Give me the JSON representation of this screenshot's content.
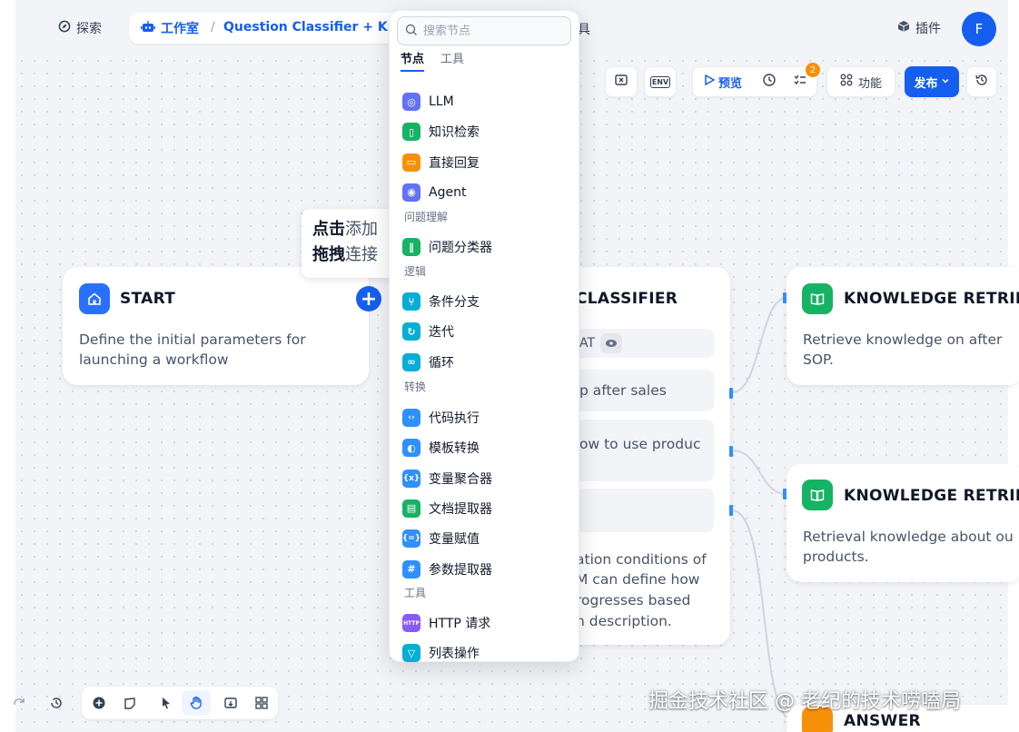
{
  "header": {
    "nav_explore": "探索",
    "nav_studio": "工作室",
    "app_name": "Question Classifier + Kn...",
    "nav_tools_tail": "具",
    "nav_plugins": "插件",
    "avatar_letter": "F"
  },
  "toolbar": {
    "env_label": "ENV",
    "preview_label": "预览",
    "checklist_count": "2",
    "features_label": "功能",
    "publish_label": "发布"
  },
  "tooltip": {
    "line1_bold": "点击",
    "line1_rest": "添加",
    "line2_bold": "拖拽",
    "line2_rest": "连接"
  },
  "dropdown": {
    "search_placeholder": "搜索节点",
    "tabs": [
      "节点",
      "工具"
    ],
    "items_main": [
      {
        "label": "LLM",
        "icon": "llm-icon",
        "color": "#6172f3"
      },
      {
        "label": "知识检索",
        "icon": "knowledge-icon",
        "color": "#16b364"
      },
      {
        "label": "直接回复",
        "icon": "reply-icon",
        "color": "#f79009"
      },
      {
        "label": "Agent",
        "icon": "agent-icon",
        "color": "#6172f3"
      }
    ],
    "group_understanding": "问题理解",
    "items_understanding": [
      {
        "label": "问题分类器",
        "icon": "classifier-icon",
        "color": "#16b364"
      }
    ],
    "group_logic": "逻辑",
    "items_logic": [
      {
        "label": "条件分支",
        "icon": "branch-icon",
        "color": "#06aed4"
      },
      {
        "label": "迭代",
        "icon": "iteration-icon",
        "color": "#06aed4"
      },
      {
        "label": "循环",
        "icon": "loop-icon",
        "color": "#06aed4"
      }
    ],
    "group_transform": "转换",
    "items_transform": [
      {
        "label": "代码执行",
        "icon": "code-icon",
        "color": "#2e90fa"
      },
      {
        "label": "模板转换",
        "icon": "template-icon",
        "color": "#2e90fa"
      },
      {
        "label": "变量聚合器",
        "icon": "aggregator-icon",
        "color": "#2e90fa"
      },
      {
        "label": "文档提取器",
        "icon": "doc-extractor-icon",
        "color": "#16b364"
      },
      {
        "label": "变量赋值",
        "icon": "assign-icon",
        "color": "#2e90fa"
      },
      {
        "label": "参数提取器",
        "icon": "param-extractor-icon",
        "color": "#2e90fa"
      }
    ],
    "group_tools": "工具",
    "items_tools": [
      {
        "label": "HTTP 请求",
        "icon": "http-icon",
        "color": "#875bf7"
      },
      {
        "label": "列表操作",
        "icon": "list-op-icon",
        "color": "#06aed4"
      }
    ]
  },
  "nodes": {
    "start": {
      "title": "START",
      "desc_line1": "Define the initial parameters for",
      "desc_line2": "launching a workflow"
    },
    "classifier": {
      "title_visible": "CLASSIFIER",
      "var_chip": "AT",
      "class1": "p after sales",
      "class2": "ow to use produc",
      "desc_line1": "ation conditions of",
      "desc_line2": "M can define how",
      "desc_line3": "rogresses based",
      "desc_line4": "n description."
    },
    "knowledge1": {
      "title": "KNOWLEDGE RETRIE",
      "desc_line1": "Retrieve knowledge on after",
      "desc_line2": "SOP."
    },
    "knowledge2": {
      "title": "KNOWLEDGE RETRIE",
      "desc_line1": "Retrieval knowledge about ou",
      "desc_line2": "products."
    },
    "answer": {
      "title": "ANSWER"
    }
  },
  "watermark": "掘金技术社区 @ 老纪的技术唠嗑局",
  "colors": {
    "primary": "#155eef",
    "start_icon": "#2970ff",
    "knowledge_icon": "#16b364",
    "answer_icon": "#f79009",
    "badge": "#f79009"
  }
}
